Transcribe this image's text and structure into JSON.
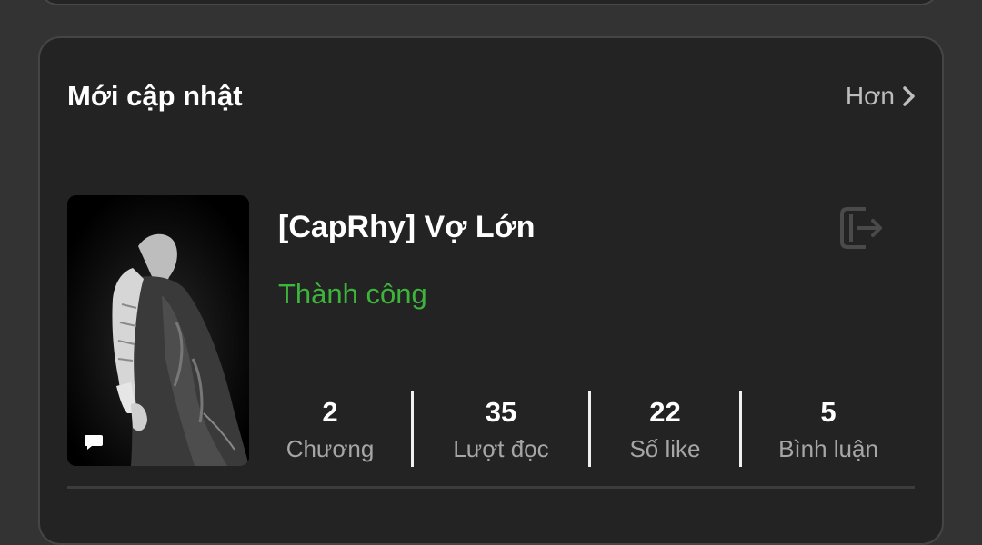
{
  "section": {
    "title": "Mới cập nhật",
    "more_label": "Hơn",
    "more_icon": "chevron-right-icon"
  },
  "story": {
    "title": "[CapRhy] Vợ Lớn",
    "status": "Thành công",
    "status_color": "#3db53d",
    "cover_badge_icon": "comment-icon",
    "action_icon": "exit-icon",
    "stats": [
      {
        "value": "2",
        "label": "Chương"
      },
      {
        "value": "35",
        "label": "Lượt đọc"
      },
      {
        "value": "22",
        "label": "Số like"
      },
      {
        "value": "5",
        "label": "Bình luận"
      }
    ]
  },
  "colors": {
    "background": "#333333",
    "card": "#232323",
    "text_primary": "#ffffff",
    "text_secondary": "#a6a6a6"
  }
}
